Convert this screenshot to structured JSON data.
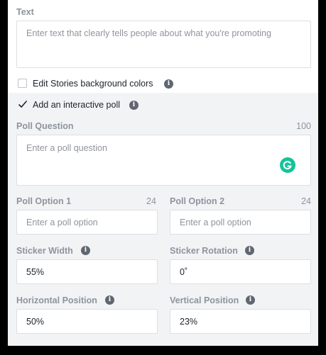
{
  "text_section": {
    "label": "Text",
    "placeholder": "Enter text that clearly tells people about what you're promoting"
  },
  "edit_bg": {
    "label": "Edit Stories background colors",
    "checked": false
  },
  "poll_toggle": {
    "label": "Add an interactive poll",
    "checked": true
  },
  "poll_question": {
    "label": "Poll Question",
    "counter": "100",
    "placeholder": "Enter a poll question"
  },
  "poll_option_1": {
    "label": "Poll Option 1",
    "counter": "24",
    "placeholder": "Enter a poll option"
  },
  "poll_option_2": {
    "label": "Poll Option 2",
    "counter": "24",
    "placeholder": "Enter a poll option"
  },
  "sticker_width": {
    "label": "Sticker Width",
    "value": "55%"
  },
  "sticker_rotation": {
    "label": "Sticker Rotation",
    "value": "0˚"
  },
  "horizontal_position": {
    "label": "Horizontal Position",
    "value": "50%"
  },
  "vertical_position": {
    "label": "Vertical Position",
    "value": "23%"
  },
  "icons": {
    "info": "info-icon",
    "checkmark": "checkmark-icon",
    "grammarly": "grammarly-icon"
  },
  "colors": {
    "panel_bg": "#f2f3f5",
    "grammarly": "#15c39a",
    "label_gray": "#8d949e"
  }
}
